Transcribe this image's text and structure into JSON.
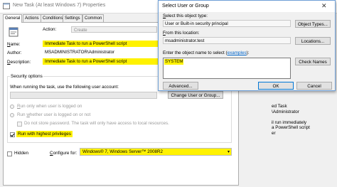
{
  "props": {
    "title": "New Task (At least Windows 7) Properties",
    "tabs": [
      "General",
      "Actions",
      "Conditions",
      "Settings",
      "Common"
    ],
    "action_label": "Action:",
    "action_value": "Create",
    "name_label": "Name:",
    "name_value": "Immediate Task to run a PowerShell script",
    "author_label": "Author:",
    "author_value": "MSADMINISTRATOR\\Administrator",
    "description_label": "Description:",
    "description_value": "Immediate Task to run a PowerShell script",
    "security_options_label": "Security options",
    "user_account_prompt": "When running the task, use the following user account:",
    "change_user_button": "Change User or Group...",
    "radio_logged_on": "Run only when user is logged on",
    "radio_whether": "Run whether user is logged on or not",
    "do_not_store": "Do not store password. The task will only have access to local resources.",
    "run_highest": "Run with highest privileges",
    "run_highest_checked": true,
    "hidden_label": "Hidden",
    "configure_label": "Configure for:",
    "configure_value": "Windows® 7, Windows Server™ 2008R2",
    "bg_right_lines": [
      "ed Task",
      "\\Administrator",
      "",
      "il run immediately",
      "a PowerShell script",
      "er"
    ]
  },
  "select_dialog": {
    "title": "Select User or Group",
    "object_type_label": "Select this object type:",
    "object_type_value": "User or Built-in security principal",
    "object_types_button": "Object Types...",
    "location_label": "From this location:",
    "location_value": "msadministrator.test",
    "locations_button": "Locations...",
    "enter_names_label": "Enter the object name to select (",
    "examples_link": "examples",
    "enter_names_suffix": "):",
    "names_value": "SYSTEM",
    "check_names_button": "Check Names",
    "advanced_button": "Advanced...",
    "ok_button": "OK",
    "cancel_button": "Cancel",
    "close_glyph": "✕"
  },
  "colors": {
    "highlight": "#fff200",
    "focus_border": "#0078d7"
  }
}
